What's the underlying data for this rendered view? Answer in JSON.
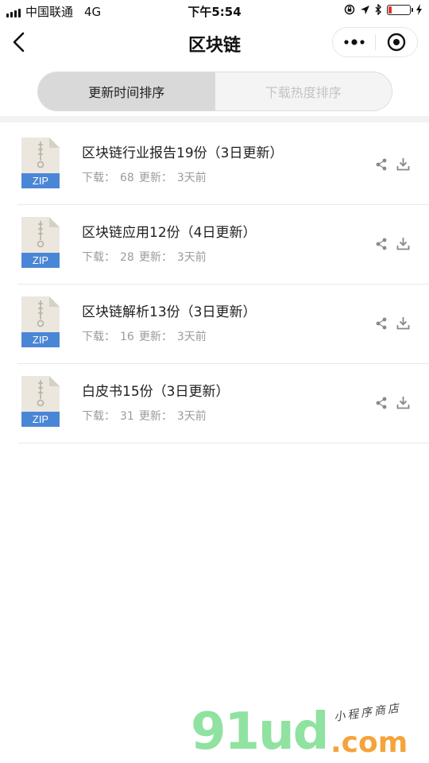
{
  "status_bar": {
    "carrier": "中国联通",
    "network": "4G",
    "time": "下午5:54",
    "battery_level": 0.15
  },
  "nav": {
    "title": "区块链",
    "back_icon": "chevron-left-icon",
    "more_icon": "more-dots-icon",
    "close_icon": "target-close-icon"
  },
  "tabs": [
    {
      "label": "更新时间排序",
      "active": true
    },
    {
      "label": "下载热度排序",
      "active": false
    }
  ],
  "files": [
    {
      "title": "区块链行业报告19份（3日更新）",
      "download_label": "下载：",
      "downloads": "68",
      "update_label": "更新：",
      "updated": "3天前",
      "icon_label": "ZIP"
    },
    {
      "title": "区块链应用12份（4日更新）",
      "download_label": "下载：",
      "downloads": "28",
      "update_label": "更新：",
      "updated": "3天前",
      "icon_label": "ZIP"
    },
    {
      "title": "区块链解析13份（3日更新）",
      "download_label": "下载：",
      "downloads": "16",
      "update_label": "更新：",
      "updated": "3天前",
      "icon_label": "ZIP"
    },
    {
      "title": "白皮书15份（3日更新）",
      "download_label": "下载：",
      "downloads": "31",
      "update_label": "更新：",
      "updated": "3天前",
      "icon_label": "ZIP"
    }
  ],
  "watermark": {
    "main": "91ud",
    "domain": ".com",
    "tagline": "小程序商店"
  },
  "colors": {
    "zip_band": "#4a86d6",
    "battery_low": "#e0342c",
    "meta_text": "#9b9b9b"
  }
}
